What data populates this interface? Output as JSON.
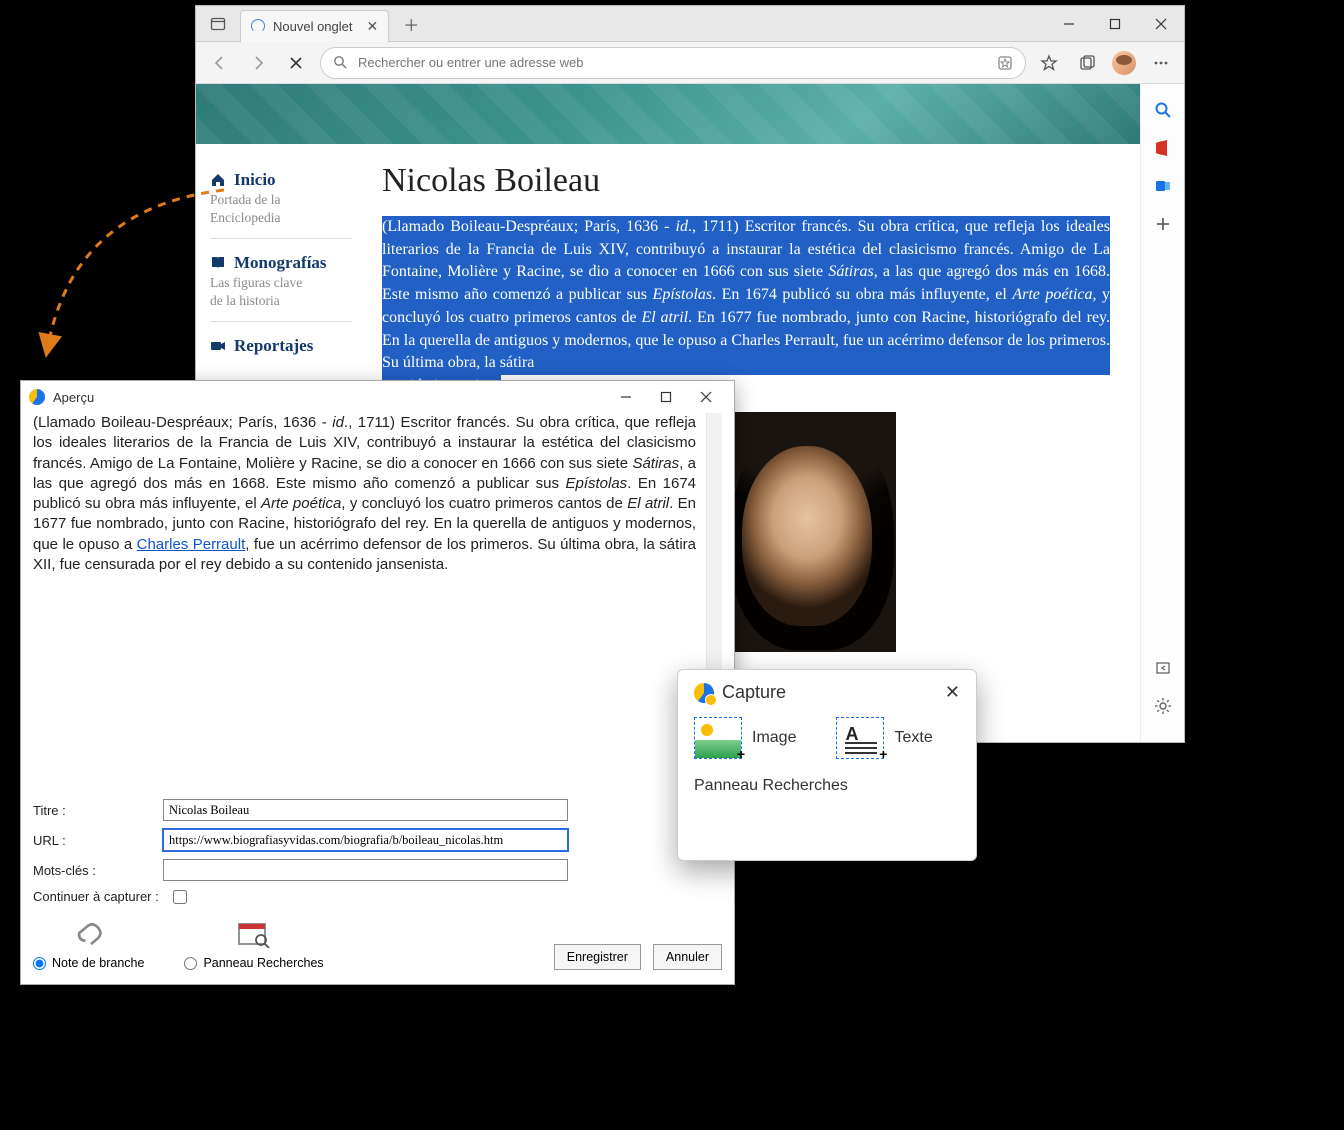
{
  "browser": {
    "tab_title": "Nouvel onglet",
    "omnibox_placeholder": "Rechercher ou entrer une adresse web"
  },
  "site": {
    "sidebar": {
      "items": [
        {
          "title": "Inicio",
          "sub1": "Portada de la",
          "sub2": "Enciclopedia"
        },
        {
          "title": "Monografías",
          "sub1": "Las figuras clave",
          "sub2": "de la historia"
        },
        {
          "title": "Reportajes",
          "sub1": "",
          "sub2": ""
        }
      ]
    },
    "article": {
      "heading": "Nicolas Boileau",
      "sel_1": "(Llamado Boileau-Despréaux; París, 1636 - ",
      "sel_id": "id",
      "sel_2": "., 1711) Escritor francés. Su obra crítica, que refleja los ideales literarios de la Francia de Luis XIV, contribuyó a instaurar la estética del clasicismo francés. Amigo de La Fontaine, Molière y Racine, se dio a conocer en 1666 con sus siete ",
      "sel_satiras": "Sátiras",
      "sel_3": ", a las que agregó dos más en 1668. Este mismo año comenzó a publicar sus ",
      "sel_epist": "Epístolas",
      "sel_4": ". En 1674 publicó su obra más influyente, el ",
      "sel_arte": "Arte poética",
      "sel_5": ", y concluyó los cuatro primeros cantos de ",
      "sel_atril": "El atril",
      "sel_6": ". En 1677 fue nombrado, junto con Racine, historiógrafo del rey. En la querella de antiguos y modernos, que le opuso a Charles Perrault, fue un acérrimo defensor de los primeros. Su última obra, la sátira ",
      "trail": "ntenido jansenista."
    }
  },
  "apercu": {
    "title": "Aperçu",
    "p1": "(Llamado Boileau-Despréaux; París, 1636 - ",
    "pid": "id",
    "p2": "., 1711) Escritor francés. Su obra crítica, que refleja los ideales literarios de la Francia de Luis XIV, contribuyó a instaurar la estética del clasicismo francés. Amigo de La Fontaine, Molière y Racine, se dio a conocer en 1666 con sus siete ",
    "psat": "Sátiras",
    "p3": ", a las que agregó dos más en 1668. Este mismo año comenzó a publicar sus ",
    "pepi": "Epístolas",
    "p4": ". En 1674 publicó su obra más influyente, el ",
    "part": "Arte poética",
    "p5": ", y concluyó los cuatro primeros cantos de ",
    "patr": "El atril",
    "p6": ". En 1677 fue nombrado, junto con Racine, historiógrafo del rey. En la querella de antiguos y modernos, que le opuso a ",
    "plink": "Charles Perrault",
    "p7": ", fue un acérrimo defensor de los primeros. Su última obra, la sátira XII, fue censurada por el rey debido a su contenido jansenista.",
    "form": {
      "titre_label": "Titre :",
      "titre_value": "Nicolas Boileau",
      "url_label": "URL :",
      "url_value": "https://www.biografiasyvidas.com/biografia/b/boileau_nicolas.htm",
      "mots_label": "Mots-clés :",
      "mots_value": "",
      "cont_label": "Continuer à capturer :",
      "note_label": "Note de branche",
      "panneau_label": "Panneau Recherches",
      "save": "Enregistrer",
      "cancel": "Annuler"
    }
  },
  "capture": {
    "title": "Capture",
    "image": "Image",
    "texte": "Texte",
    "footer": "Panneau Recherches"
  }
}
